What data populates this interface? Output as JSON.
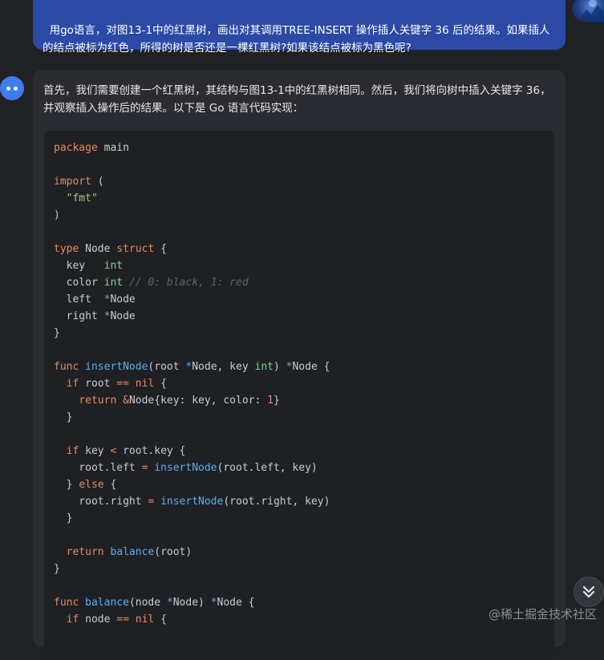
{
  "user_message": {
    "text": "用go语言，对图13-1中的红黑树，画出对其调用TREE-INSERT 操作插人关键字 36 后的结果。如果插人的结点被标为红色，所得的树是否还是一棵红黑树?如果该结点被标为黑色呢?"
  },
  "assistant_message": {
    "intro": "首先，我们需要创建一个红黑树，其结构与图13-1中的红黑树相同。然后，我们将向树中插入关键字 36，并观察插入操作后的结果。以下是 Go 语言代码实现：",
    "code_lines": [
      [
        [
          "kw",
          "package"
        ],
        [
          "p",
          " main"
        ]
      ],
      [],
      [
        [
          "kw",
          "import"
        ],
        [
          "p",
          " ("
        ]
      ],
      [
        [
          "p",
          "  "
        ],
        [
          "st",
          "\"fmt\""
        ]
      ],
      [
        [
          "p",
          ")"
        ]
      ],
      [],
      [
        [
          "kw",
          "type"
        ],
        [
          "p",
          " Node "
        ],
        [
          "kw",
          "struct"
        ],
        [
          "p",
          " {"
        ]
      ],
      [
        [
          "p",
          "  key   "
        ],
        [
          "ty",
          "int"
        ]
      ],
      [
        [
          "p",
          "  color "
        ],
        [
          "ty",
          "int"
        ],
        [
          "p",
          " "
        ],
        [
          "cm",
          "// 0: black, 1: red"
        ]
      ],
      [
        [
          "p",
          "  left  "
        ],
        [
          "pt",
          "*"
        ],
        [
          "p",
          "Node"
        ]
      ],
      [
        [
          "p",
          "  right "
        ],
        [
          "pt",
          "*"
        ],
        [
          "p",
          "Node"
        ]
      ],
      [
        [
          "p",
          "}"
        ]
      ],
      [],
      [
        [
          "kw",
          "func"
        ],
        [
          "p",
          " "
        ],
        [
          "fn",
          "insertNode"
        ],
        [
          "p",
          "(root "
        ],
        [
          "pt",
          "*"
        ],
        [
          "p",
          "Node, key "
        ],
        [
          "ty",
          "int"
        ],
        [
          "p",
          ") "
        ],
        [
          "pt",
          "*"
        ],
        [
          "p",
          "Node {"
        ]
      ],
      [
        [
          "p",
          "  "
        ],
        [
          "kw",
          "if"
        ],
        [
          "p",
          " root "
        ],
        [
          "op",
          "=="
        ],
        [
          "p",
          " "
        ],
        [
          "kw",
          "nil"
        ],
        [
          "p",
          " {"
        ]
      ],
      [
        [
          "p",
          "    "
        ],
        [
          "kw",
          "return"
        ],
        [
          "p",
          " "
        ],
        [
          "op",
          "&"
        ],
        [
          "p",
          "Node{key: key, color: "
        ],
        [
          "nm",
          "1"
        ],
        [
          "p",
          "}"
        ]
      ],
      [
        [
          "p",
          "  }"
        ]
      ],
      [],
      [
        [
          "p",
          "  "
        ],
        [
          "kw",
          "if"
        ],
        [
          "p",
          " key "
        ],
        [
          "op",
          "<"
        ],
        [
          "p",
          " root.key {"
        ]
      ],
      [
        [
          "p",
          "    root.left "
        ],
        [
          "op",
          "="
        ],
        [
          "p",
          " "
        ],
        [
          "fn",
          "insertNode"
        ],
        [
          "p",
          "(root.left, key)"
        ]
      ],
      [
        [
          "p",
          "  } "
        ],
        [
          "kw",
          "else"
        ],
        [
          "p",
          " {"
        ]
      ],
      [
        [
          "p",
          "    root.right "
        ],
        [
          "op",
          "="
        ],
        [
          "p",
          " "
        ],
        [
          "fn",
          "insertNode"
        ],
        [
          "p",
          "(root.right, key)"
        ]
      ],
      [
        [
          "p",
          "  }"
        ]
      ],
      [],
      [
        [
          "p",
          "  "
        ],
        [
          "kw",
          "return"
        ],
        [
          "p",
          " "
        ],
        [
          "fn",
          "balance"
        ],
        [
          "p",
          "(root)"
        ]
      ],
      [
        [
          "p",
          "}"
        ]
      ],
      [],
      [
        [
          "kw",
          "func"
        ],
        [
          "p",
          " "
        ],
        [
          "fn",
          "balance"
        ],
        [
          "p",
          "(node "
        ],
        [
          "pt",
          "*"
        ],
        [
          "p",
          "Node) "
        ],
        [
          "pt",
          "*"
        ],
        [
          "p",
          "Node {"
        ]
      ],
      [
        [
          "p",
          "  "
        ],
        [
          "kw",
          "if"
        ],
        [
          "p",
          " node "
        ],
        [
          "op",
          "=="
        ],
        [
          "p",
          " "
        ],
        [
          "kw",
          "nil"
        ],
        [
          "p",
          " {"
        ]
      ]
    ]
  },
  "watermark": "@稀土掘金技术社区",
  "icons": {
    "scroll": "double-chevron-down-icon",
    "assistant_avatar": "chat-bot-icon",
    "user_avatar": "user-avatar"
  },
  "colors": {
    "user_bubble": "#2a4aa6",
    "bot_bubble": "#2b2c31",
    "code_bg": "#1f2024",
    "keyword": "#e88b5a",
    "type": "#7bd88f",
    "function": "#5aaef0",
    "string": "#a6cc70"
  }
}
